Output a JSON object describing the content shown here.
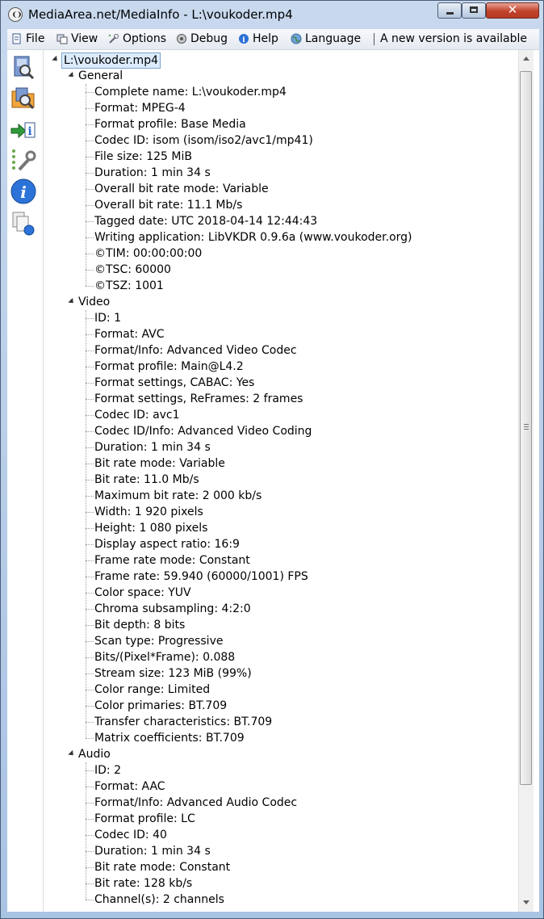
{
  "window": {
    "title": "MediaArea.net/MediaInfo - L:\\voukoder.mp4",
    "minimize_icon": "minimize-icon",
    "maximize_icon": "maximize-icon",
    "close_label": "✕"
  },
  "menu": {
    "items": [
      {
        "label": "File",
        "icon": "file-icon"
      },
      {
        "label": "View",
        "icon": "view-icon"
      },
      {
        "label": "Options",
        "icon": "options-icon"
      },
      {
        "label": "Debug",
        "icon": "debug-icon"
      },
      {
        "label": "Help",
        "icon": "help-icon"
      },
      {
        "label": "Language",
        "icon": "globe-icon"
      }
    ],
    "update_notice": "A new version is available"
  },
  "toolbar": {
    "icons": [
      "open-file-icon",
      "open-folder-icon",
      "export-icon",
      "preferences-icon",
      "about-icon",
      "sheet-view-icon"
    ]
  },
  "tree": {
    "root": "L:\\voukoder.mp4",
    "sections": [
      {
        "name": "General",
        "items": [
          "Complete name: L:\\voukoder.mp4",
          "Format: MPEG-4",
          "Format profile: Base Media",
          "Codec ID: isom (isom/iso2/avc1/mp41)",
          "File size: 125 MiB",
          "Duration: 1 min 34 s",
          "Overall bit rate mode: Variable",
          "Overall bit rate: 11.1 Mb/s",
          "Tagged date: UTC 2018-04-14 12:44:43",
          "Writing application: LibVKDR 0.9.6a (www.voukoder.org)",
          "©TIM: 00:00:00:00",
          "©TSC: 60000",
          "©TSZ: 1001"
        ]
      },
      {
        "name": "Video",
        "items": [
          "ID: 1",
          "Format: AVC",
          "Format/Info: Advanced Video Codec",
          "Format profile: Main@L4.2",
          "Format settings, CABAC: Yes",
          "Format settings, ReFrames: 2 frames",
          "Codec ID: avc1",
          "Codec ID/Info: Advanced Video Coding",
          "Duration: 1 min 34 s",
          "Bit rate mode: Variable",
          "Bit rate: 11.0 Mb/s",
          "Maximum bit rate: 2 000 kb/s",
          "Width: 1 920 pixels",
          "Height: 1 080 pixels",
          "Display aspect ratio: 16:9",
          "Frame rate mode: Constant",
          "Frame rate: 59.940 (60000/1001) FPS",
          "Color space: YUV",
          "Chroma subsampling: 4:2:0",
          "Bit depth: 8 bits",
          "Scan type: Progressive",
          "Bits/(Pixel*Frame): 0.088",
          "Stream size: 123 MiB (99%)",
          "Color range: Limited",
          "Color primaries: BT.709",
          "Transfer characteristics: BT.709",
          "Matrix coefficients: BT.709"
        ]
      },
      {
        "name": "Audio",
        "items": [
          "ID: 2",
          "Format: AAC",
          "Format/Info: Advanced Audio Codec",
          "Format profile: LC",
          "Codec ID: 40",
          "Duration: 1 min 34 s",
          "Bit rate mode: Constant",
          "Bit rate: 128 kb/s",
          "Channel(s): 2 channels"
        ]
      }
    ]
  }
}
